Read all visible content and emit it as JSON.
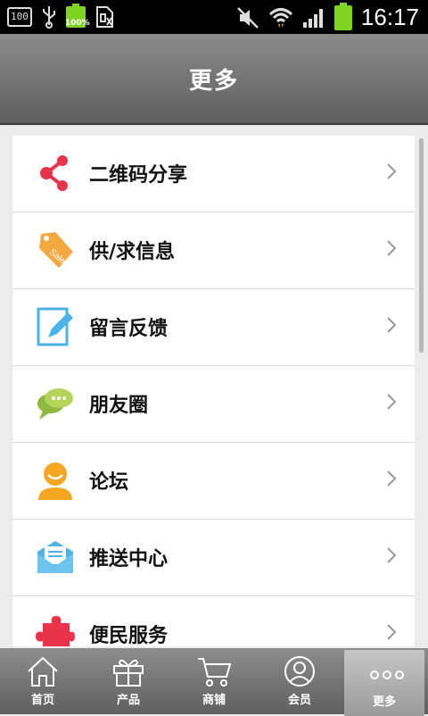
{
  "status_bar": {
    "badge_left": "100",
    "battery_percent": "100%",
    "time": "16:17"
  },
  "header": {
    "title": "更多"
  },
  "menu": {
    "items": [
      {
        "label": "二维码分享",
        "icon": "share-icon"
      },
      {
        "label": "供/求信息",
        "icon": "sale-tag-icon"
      },
      {
        "label": "留言反馈",
        "icon": "edit-note-icon"
      },
      {
        "label": "朋友圈",
        "icon": "chat-bubbles-icon"
      },
      {
        "label": "论坛",
        "icon": "user-smile-icon"
      },
      {
        "label": "推送中心",
        "icon": "envelope-icon"
      },
      {
        "label": "便民服务",
        "icon": "puzzle-icon"
      }
    ]
  },
  "bottom_nav": {
    "tabs": [
      {
        "label": "首页",
        "icon": "home-icon"
      },
      {
        "label": "产品",
        "icon": "gift-icon"
      },
      {
        "label": "商铺",
        "icon": "cart-icon"
      },
      {
        "label": "会员",
        "icon": "member-icon"
      },
      {
        "label": "更多",
        "icon": "more-dots-icon",
        "active": true
      }
    ]
  },
  "colors": {
    "header_bg": "#6f6f6f",
    "share_red": "#e8344a",
    "tag_orange": "#f4a940",
    "edit_blue": "#4ab3e8",
    "chat_green": "#9fc846",
    "user_orange": "#f5a623"
  }
}
